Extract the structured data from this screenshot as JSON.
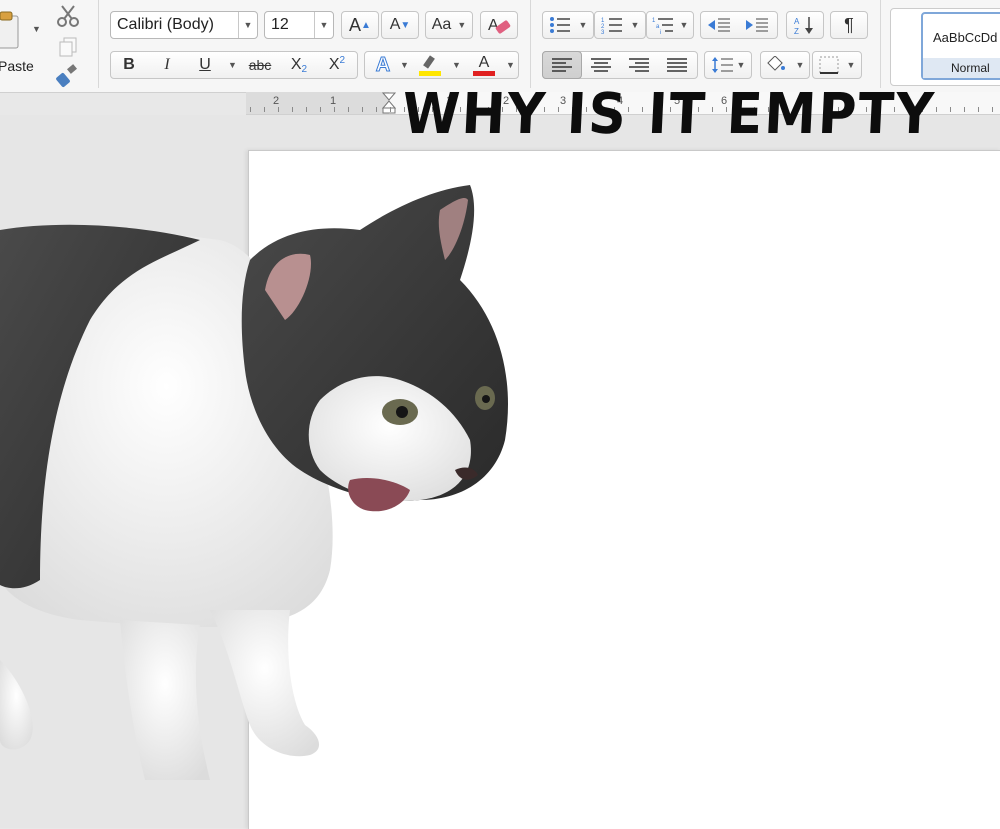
{
  "ribbon": {
    "paste_label": "Paste",
    "font_name": "Calibri (Body)",
    "font_size": "12",
    "grow_font": "A",
    "shrink_font": "A",
    "change_case": "Aa",
    "bold": "B",
    "italic": "I",
    "underline": "U",
    "strikethrough": "abc",
    "subscript_main": "X",
    "subscript_small": "2",
    "superscript_main": "X",
    "superscript_small": "2",
    "text_effects": "A",
    "highlight": "A",
    "font_color": "A",
    "pilcrow": "¶",
    "style_preview": "AaBbCcDd",
    "style_name": "Normal",
    "highlight_color": "#ffe600",
    "font_color_bar": "#e02020",
    "accent": "#3a7bd5"
  },
  "ruler": {
    "numbers": [
      "2",
      "1",
      "1",
      "2",
      "3",
      "4",
      "5",
      "6"
    ]
  },
  "meme": {
    "caption": "WHY IS IT EMPTY"
  }
}
